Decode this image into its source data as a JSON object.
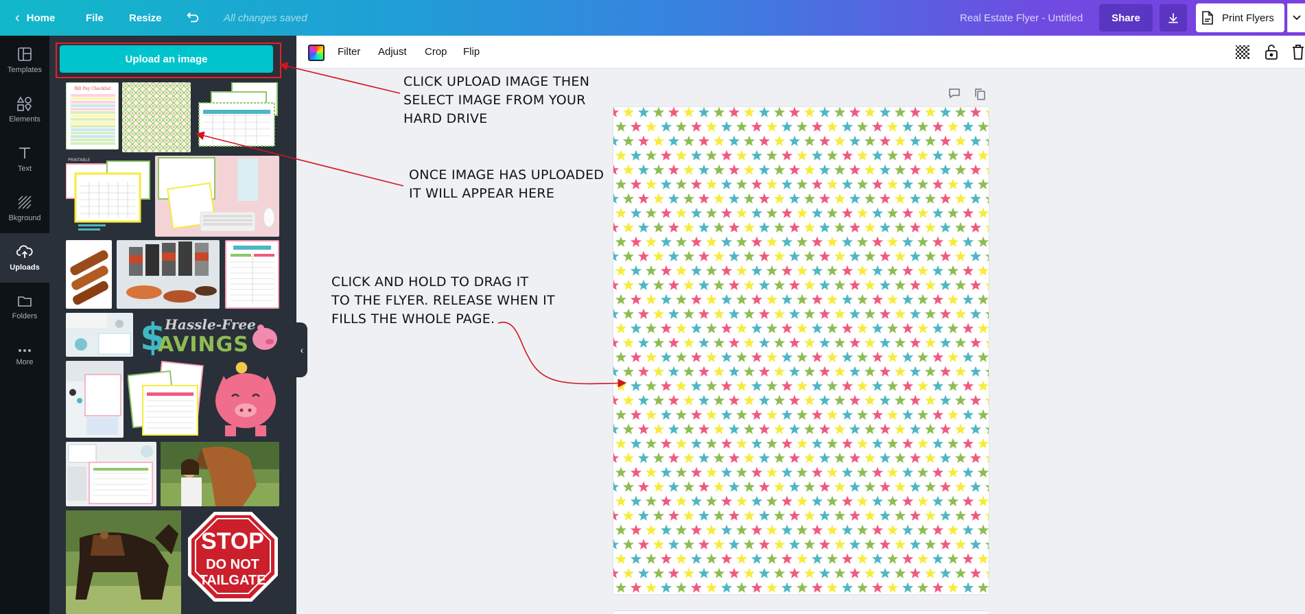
{
  "topbar": {
    "home_label": "Home",
    "file_label": "File",
    "resize_label": "Resize",
    "save_status": "All changes saved",
    "document_title": "Real Estate Flyer - Untitled",
    "share_label": "Share",
    "print_label": "Print Flyers"
  },
  "rail": {
    "items": [
      {
        "label": "Templates",
        "icon": "templates-icon"
      },
      {
        "label": "Elements",
        "icon": "elements-icon"
      },
      {
        "label": "Text",
        "icon": "text-icon"
      },
      {
        "label": "Bkground",
        "icon": "background-icon"
      },
      {
        "label": "Uploads",
        "icon": "upload-icon",
        "active": true
      },
      {
        "label": "Folders",
        "icon": "folder-icon"
      },
      {
        "label": "More",
        "icon": "more-icon"
      }
    ]
  },
  "panel": {
    "upload_button_label": "Upload an image",
    "thumbnail_text": {
      "checklist": "Bill Pay Checklist",
      "printable": "PRINTABLE",
      "savings_logo": "Hassle-Free SAVINGS",
      "stop_sign_line1": "STOP",
      "stop_sign_line2": "DO NOT",
      "stop_sign_line3": "TAILGATE"
    }
  },
  "edit_toolbar": {
    "filter_label": "Filter",
    "adjust_label": "Adjust",
    "crop_label": "Crop",
    "flip_label": "Flip"
  },
  "annotations": {
    "note1": [
      "CLICK UPLOAD IMAGE THEN",
      "SELECT IMAGE FROM YOUR",
      "HARD DRIVE"
    ],
    "note2": [
      "ONCE IMAGE HAS UPLOADED",
      "IT WILL APPEAR HERE"
    ],
    "note3": [
      "CLICK AND HOLD TO DRAG IT",
      "TO THE FLYER. RELEASE WHEN IT",
      "FILLS THE WHOLE PAGE."
    ]
  },
  "colors": {
    "accent": "#00c4cc",
    "annotation": "#d0161f",
    "star_pink": "#ef5b80",
    "star_yellow": "#f6ec3c",
    "star_teal": "#4fb6c4",
    "star_green": "#8ebd52"
  }
}
